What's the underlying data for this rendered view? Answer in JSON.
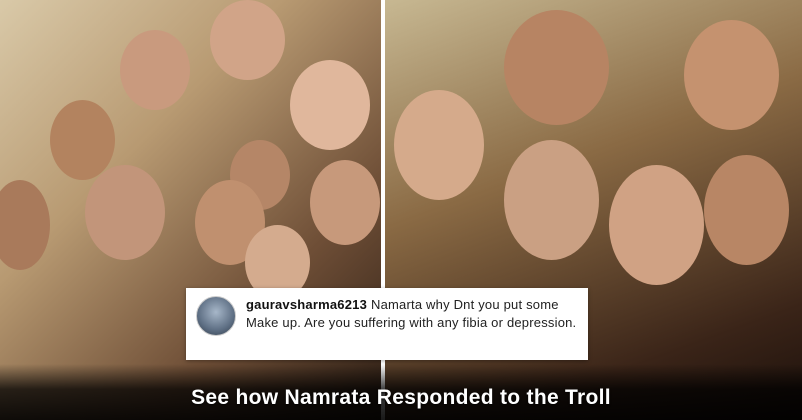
{
  "comment": {
    "username": "gauravsharma6213",
    "text": "Namarta why Dnt you put some Make up. Are you suffering with any fibia or depression."
  },
  "caption": "See how Namrata Responded to the Troll"
}
